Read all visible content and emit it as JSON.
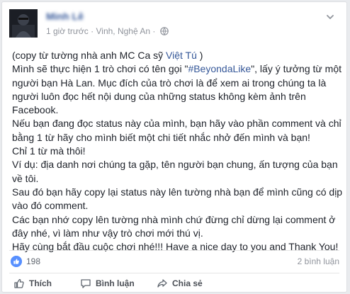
{
  "post": {
    "author": "Minh Lê",
    "time": "1 giờ trước",
    "separator": "·",
    "location": "Vinh, Nghệ An",
    "separator2": "·",
    "body": {
      "l1_a": "(copy từ tường nhà anh MC Ca sỹ ",
      "l1_link": "Việt Tú",
      "l1_b": " )",
      "l2_a": "Mình sẽ thực hiện 1 trò chơi có tên gọi \"",
      "l2_link": "#BeyondaLike",
      "l2_b": "\", lấy ý tưởng từ một người bạn Hà Lan. Mục đích của trò chơi là để xem ai trong chúng ta là người luôn đọc hết nội dung của những status không kèm ảnh trên Facebook.",
      "l3": "Nếu bạn đang đọc status này của mình, bạn hãy vào phần comment và chỉ bằng 1 từ hãy cho mình biết một chi tiết nhắc nhở đến mình và bạn!",
      "l4": "Chỉ 1 từ mà thôi!",
      "l5": "Ví dụ: địa danh nơi chúng ta gặp, tên người bạn chung, ấn tượng của bạn về tôi.",
      "l6": "Sau đó bạn hãy copy lại status này lên tường nhà bạn để mình cũng có dịp vào đó comment.",
      "l7": "Các bạn nhớ copy lên tường nhà mình chứ đừng chỉ dừng lại comment ở đây nhé, vì làm như vậy trò chơi mới thú vị.",
      "l8": "Hãy cùng bắt đầu cuộc chơi nhé!!! Have a nice day to you and Thank You!"
    }
  },
  "reactions": {
    "like_count": "198",
    "comment_count": "2 bình luận"
  },
  "actions": {
    "like": "Thích",
    "comment": "Bình luận",
    "share": "Chia sẻ"
  },
  "icons": {
    "location": "globe-icon",
    "menu": "chevron-down-icon",
    "like_badge": "thumbs-up-icon",
    "like": "thumbs-up-icon",
    "comment": "comment-bubble-icon",
    "share": "share-arrow-icon"
  },
  "colors": {
    "link": "#365899",
    "like_badge": "#5890ff",
    "meta": "#90949c",
    "action": "#4b4f56"
  }
}
